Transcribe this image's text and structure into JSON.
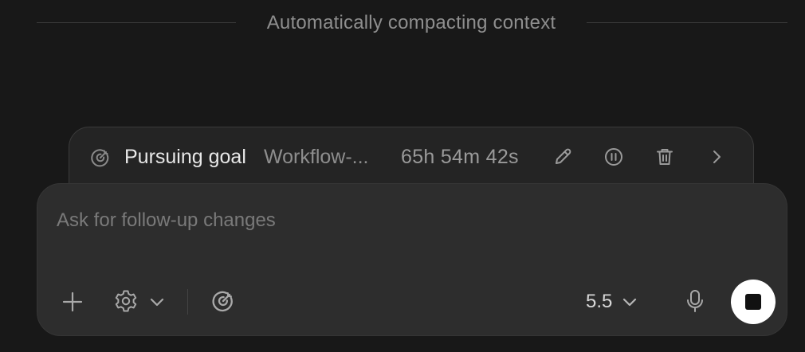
{
  "status": {
    "divider_text": "Automatically compacting context"
  },
  "goal": {
    "icon": "goal-target-icon",
    "title": "Pursuing goal",
    "name": "Workflow-...",
    "timer": "65h 54m 42s",
    "actions": [
      "edit-icon",
      "pause-icon",
      "delete-icon",
      "chevron-right-icon"
    ]
  },
  "composer": {
    "value": "",
    "placeholder": "Ask for follow-up changes",
    "tools": [
      "plus-icon",
      "settings-icon",
      "chevron-down-icon",
      "goal-target-icon"
    ],
    "model_label": "5.5",
    "send_state": "stop"
  },
  "colors": {
    "background": "#181818",
    "panel": "#2d2d2d",
    "goal_bar": "#242424",
    "text_primary": "#e8e8e8",
    "text_muted": "#8e8e8e",
    "stop_button": "#ffffff"
  }
}
